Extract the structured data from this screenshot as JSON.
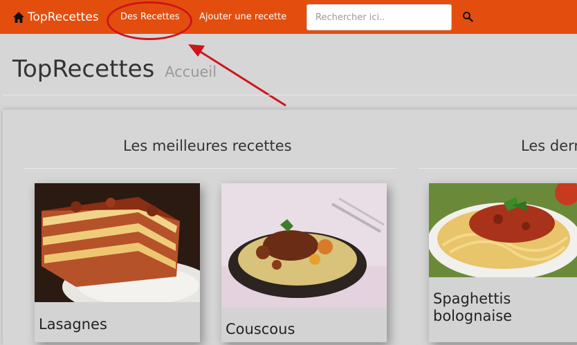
{
  "navbar": {
    "brand": "TopRecettes",
    "links": {
      "recipes": "Des Recettes",
      "add": "Ajouter une recette"
    },
    "search": {
      "placeholder": "Rechercher ici.."
    }
  },
  "header": {
    "title": "TopRecettes",
    "subtitle": "Accueil"
  },
  "sections": {
    "best": {
      "title": "Les meilleures recettes"
    },
    "latest": {
      "title": "Les dern"
    }
  },
  "cards": [
    {
      "title": "Lasagnes",
      "image": "lasagna"
    },
    {
      "title": "Couscous",
      "image": "couscous"
    },
    {
      "title": "Spaghettis bolognaise",
      "image": "spaghetti"
    }
  ],
  "colors": {
    "navbar": "#e34e0e",
    "annotation": "#d0141a",
    "background": "#d6d6d6"
  }
}
